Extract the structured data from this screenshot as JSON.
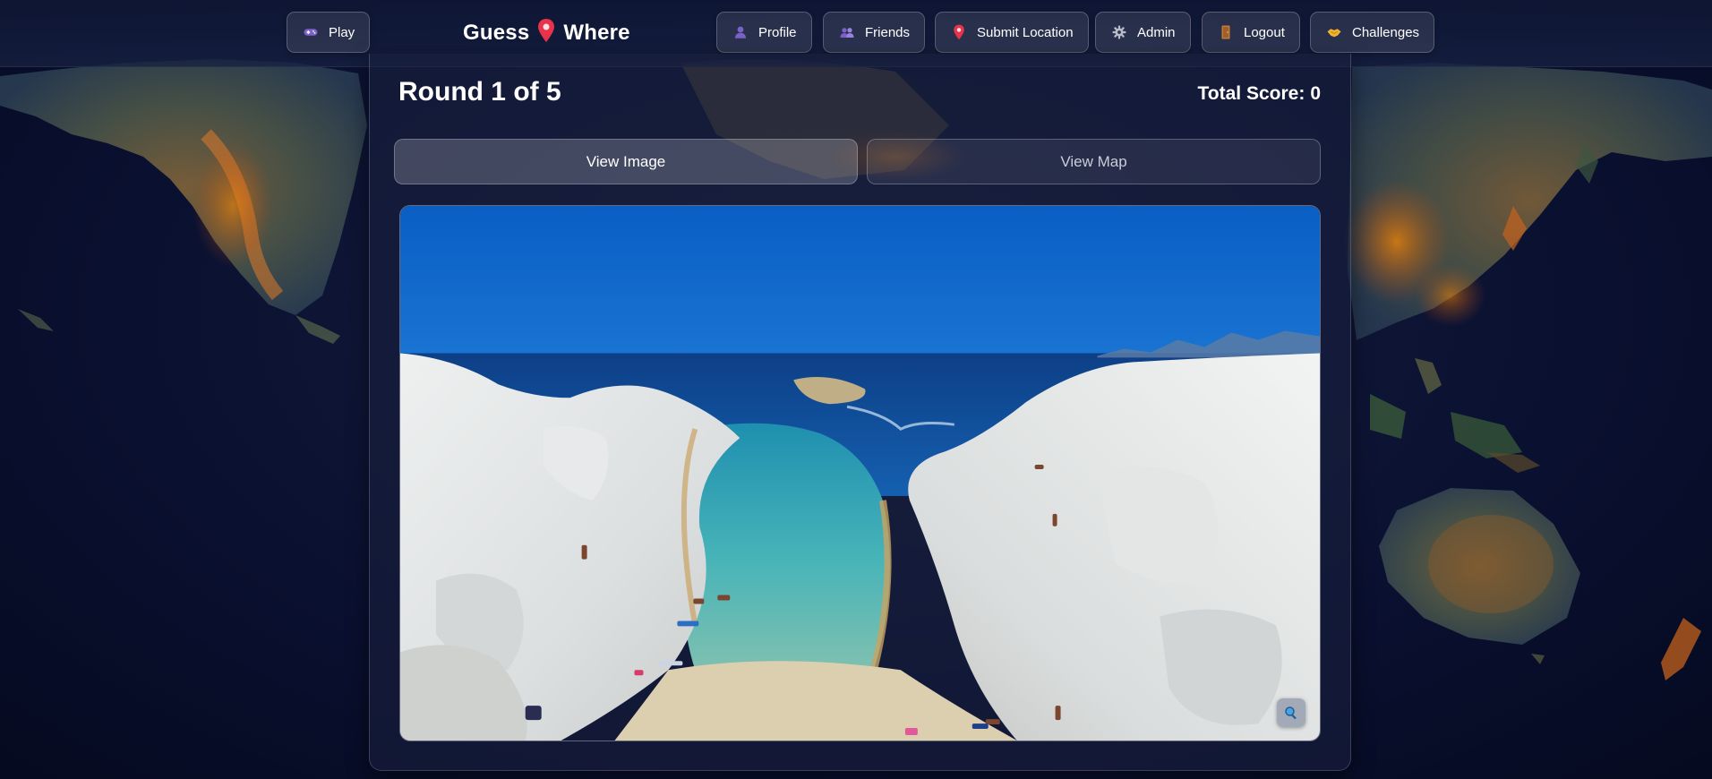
{
  "nav": {
    "play": "Play",
    "brand_left": "Guess",
    "brand_right": "Where",
    "profile": "Profile",
    "friends": "Friends",
    "submit_location": "Submit Location",
    "admin": "Admin",
    "logout": "Logout",
    "challenges": "Challenges"
  },
  "game": {
    "round_title": "Round 1 of 5",
    "score_label": "Total Score:",
    "score_value": "0",
    "tab_image": "View Image",
    "tab_map": "View Map"
  },
  "icons": {
    "play": "gamepad-icon",
    "brand": "pin-icon",
    "profile": "user-icon",
    "friends": "users-icon",
    "submit_location": "pin-icon",
    "admin": "gear-icon",
    "logout": "door-icon",
    "challenges": "handshake-icon",
    "zoom": "magnifier-icon"
  },
  "colors": {
    "accent_pin": "#e8334a",
    "icon_purple": "#7b62c9",
    "sea": "#1577c9",
    "sky": "#0a63c7"
  }
}
